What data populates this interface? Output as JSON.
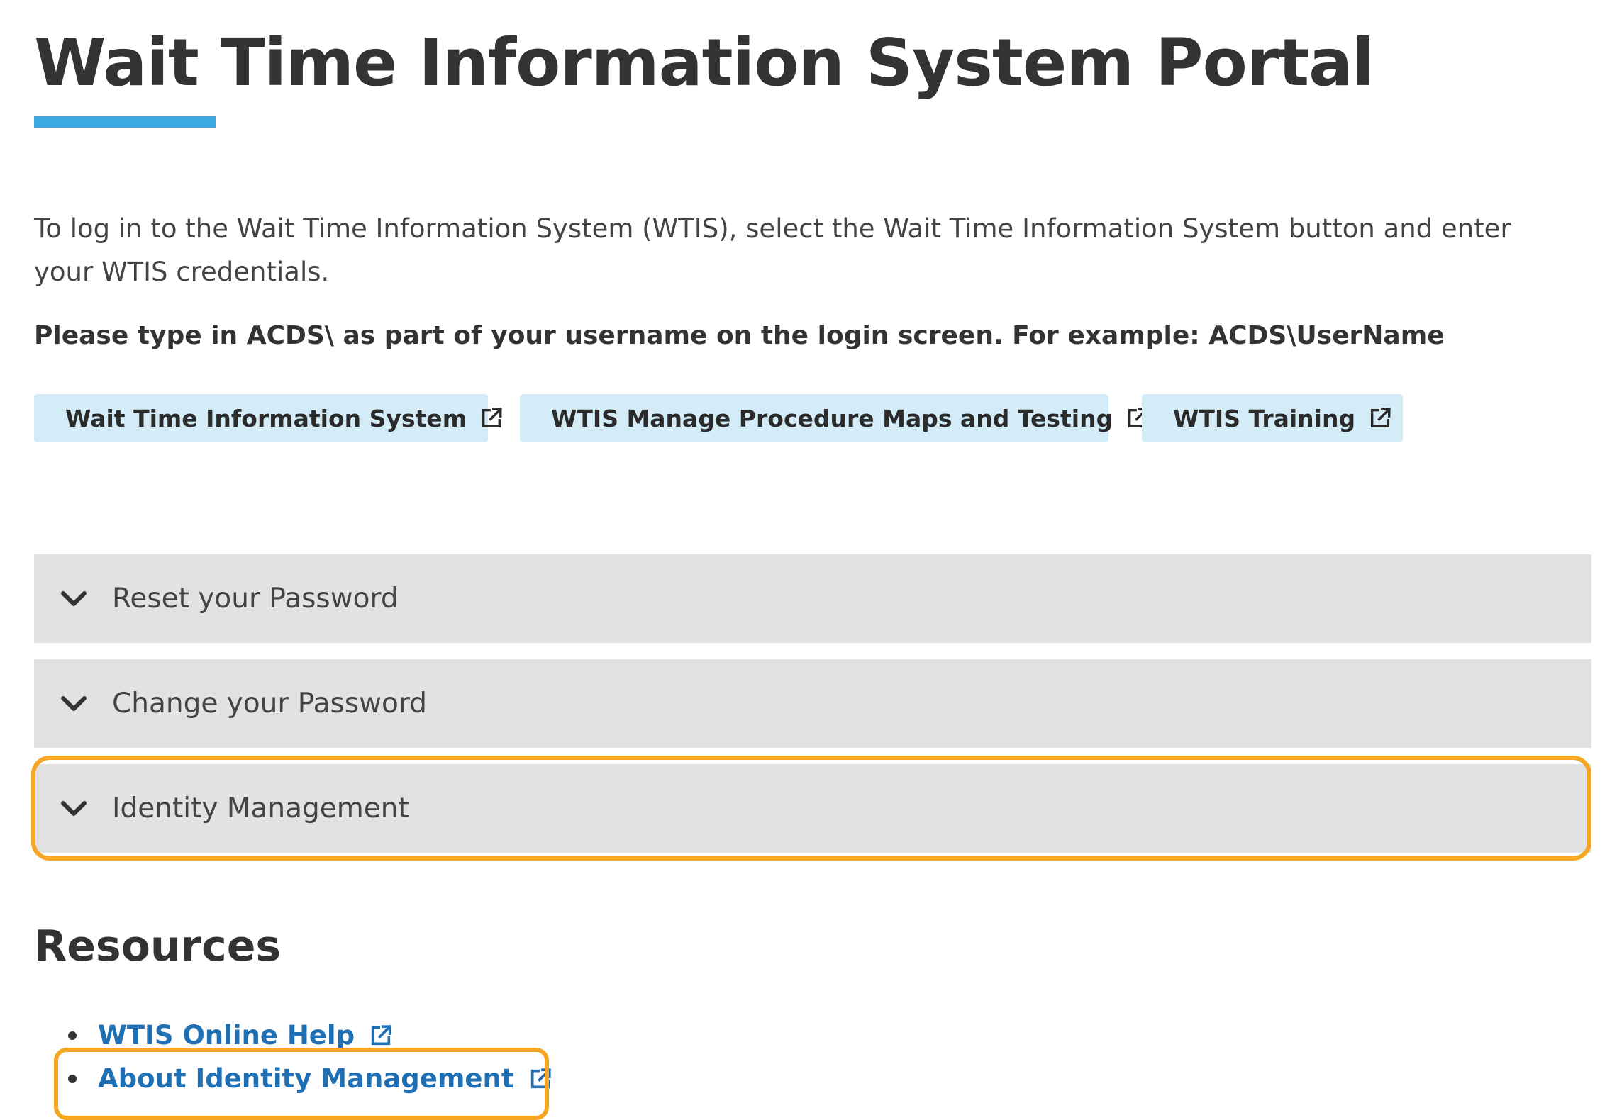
{
  "page": {
    "title": "Wait Time Information System Portal",
    "accent_color": "#3aa9e0",
    "highlight_color": "#f5a623"
  },
  "intro": {
    "text": "To log in to the Wait Time Information System (WTIS), select the Wait Time Information System button and enter your WTIS credentials.",
    "note": "Please type in ACDS\\ as part of your username on the login screen. For example: ACDS\\UserName"
  },
  "buttons": [
    {
      "label": "Wait Time Information System",
      "icon": "external-link-icon"
    },
    {
      "label": "WTIS Manage Procedure Maps and Testing",
      "icon": "external-link-icon"
    },
    {
      "label": "WTIS Training",
      "icon": "external-link-icon"
    }
  ],
  "accordion": [
    {
      "label": "Reset your Password",
      "icon": "chevron-down-icon",
      "expanded": false
    },
    {
      "label": "Change your Password",
      "icon": "chevron-down-icon",
      "expanded": false
    },
    {
      "label": "Identity Management",
      "icon": "chevron-down-icon",
      "expanded": false,
      "highlighted": true
    }
  ],
  "resources": {
    "heading": "Resources",
    "links": [
      {
        "label": "WTIS Online Help",
        "icon": "external-link-icon"
      },
      {
        "label": "About Identity Management",
        "icon": "external-link-icon",
        "highlighted": true
      }
    ]
  }
}
